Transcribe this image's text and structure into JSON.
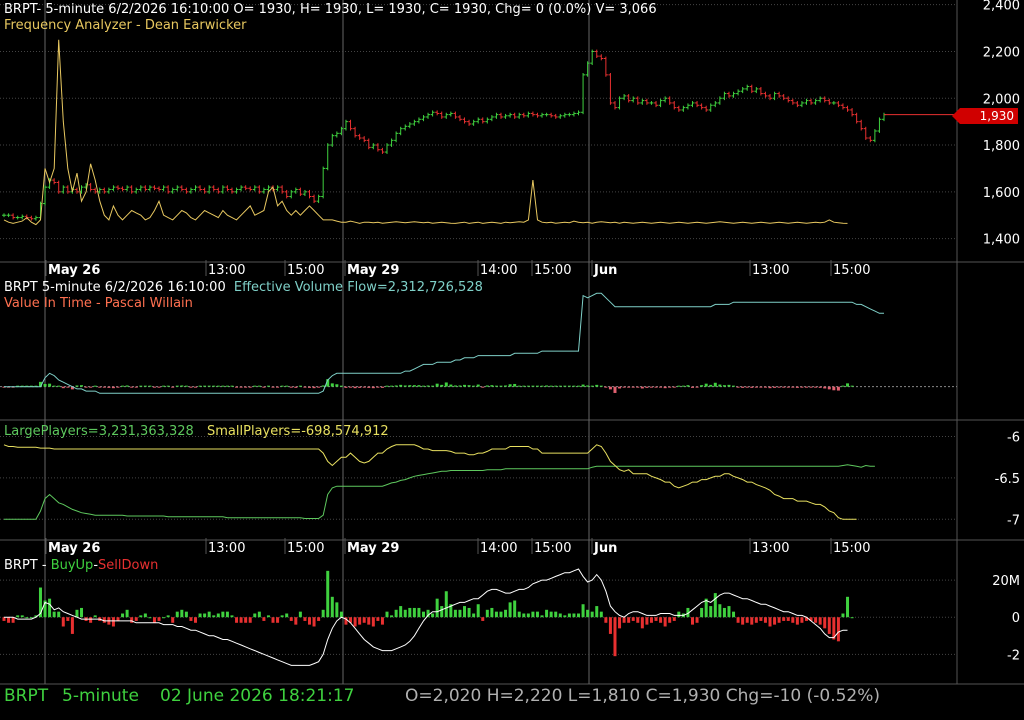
{
  "panel1": {
    "header": "BRPT- 5-minute 6/2/2026 16:10:00 O= 1930, H= 1930, L= 1930, C= 1930, Chg= 0 (0.0%) V= 3,066",
    "subtitle": "Frequency Analyzer - Dean Earwicker"
  },
  "panel2": {
    "header_prefix": "BRPT 5-minute  6/2/2026 16:10:00",
    "header_series": "Effective Volume Flow=2,312,726,528",
    "subtitle": "Value In Time - Pascal Willain"
  },
  "panel3": {
    "large_label": "LargePlayers=3,231,363,328",
    "small_label": "SmallPlayers=-698,574,912"
  },
  "panel4": {
    "prefix": "BRPT - ",
    "buy": "BuyUp",
    "dash": "-",
    "sell": "SellDown"
  },
  "price_tag": "1,930",
  "footer": {
    "symbol": "BRPT",
    "interval": "5-minute",
    "datetime": "02 June 2026 18:21:17",
    "ohlc": "O=2,020  H=2,220  L=1,810  C=1,930  Chg=-10 (-0.52%)"
  },
  "colors": {
    "up": "#3fd13f",
    "down": "#e83030",
    "freq": "#e8c860",
    "evf": "#7fd0c8",
    "large": "#5ec85e",
    "small": "#e8e060",
    "line4": "#ffffff",
    "axis_text": "#ffffff",
    "grid": "#444444"
  },
  "chart_data": {
    "type": "line",
    "date_labels": [
      "May 26",
      "13:00",
      "15:00",
      "May 29",
      "14:00",
      "15:00",
      "Jun",
      "13:00",
      "15:00"
    ],
    "price_axis": {
      "ylim": [
        1300,
        2420
      ],
      "ticks": [
        "1,400",
        "1,600",
        "1,800",
        "2,000",
        "2,200",
        "2,400"
      ]
    },
    "players_axis": {
      "ylim": [
        -7.25,
        -5.8
      ],
      "ticks": [
        "-6",
        "-6.5",
        "-7"
      ]
    },
    "buysell_axis": {
      "ylim": [
        -3.6,
        3.3
      ],
      "ticks": [
        "20M",
        "0",
        "-2"
      ]
    },
    "price_close": [
      1500,
      1500,
      1490,
      1490,
      1495,
      1490,
      1485,
      1490,
      1550,
      1620,
      1650,
      1640,
      1600,
      1620,
      1600,
      1610,
      1600,
      1620,
      1630,
      1610,
      1600,
      1610,
      1600,
      1610,
      1620,
      1615,
      1610,
      1620,
      1600,
      1610,
      1620,
      1610,
      1620,
      1615,
      1610,
      1620,
      1600,
      1610,
      1620,
      1610,
      1600,
      1610,
      1620,
      1610,
      1600,
      1620,
      1610,
      1600,
      1620,
      1610,
      1600,
      1610,
      1620,
      1615,
      1610,
      1620,
      1600,
      1610,
      1620,
      1610,
      1620,
      1600,
      1580,
      1600,
      1610,
      1590,
      1600,
      1580,
      1560,
      1580,
      1700,
      1800,
      1840,
      1850,
      1870,
      1900,
      1870,
      1840,
      1830,
      1820,
      1790,
      1800,
      1780,
      1770,
      1800,
      1820,
      1850,
      1870,
      1880,
      1890,
      1900,
      1910,
      1920,
      1930,
      1940,
      1935,
      1920,
      1930,
      1935,
      1920,
      1910,
      1900,
      1890,
      1900,
      1910,
      1900,
      1910,
      1920,
      1930,
      1920,
      1925,
      1930,
      1920,
      1930,
      1925,
      1935,
      1930,
      1925,
      1930,
      1930,
      1925,
      1920,
      1925,
      1930,
      1930,
      1935,
      1940,
      2100,
      2150,
      2200,
      2180,
      2170,
      2100,
      1980,
      1960,
      2000,
      2010,
      1990,
      2000,
      1980,
      1990,
      1980,
      1980,
      1970,
      1990,
      2000,
      1980,
      1960,
      1950,
      1960,
      1970,
      1980,
      1970,
      1960,
      1950,
      1970,
      1980,
      2000,
      2020,
      2010,
      2020,
      2030,
      2040,
      2050,
      2030,
      2040,
      2020,
      2010,
      2000,
      2020,
      2010,
      2000,
      1990,
      1980,
      1970,
      1980,
      1990,
      1980,
      1990,
      2000,
      1990,
      1980,
      1980,
      1970,
      1960,
      1950,
      1930,
      1900,
      1870,
      1830,
      1820,
      1860,
      1910,
      1930
    ],
    "frequency_analyzer": [
      1480,
      1470,
      1465,
      1470,
      1475,
      1490,
      1470,
      1460,
      1480,
      1700,
      1640,
      1700,
      2250,
      1900,
      1700,
      1600,
      1680,
      1560,
      1600,
      1720,
      1650,
      1560,
      1500,
      1480,
      1540,
      1500,
      1480,
      1500,
      1520,
      1510,
      1500,
      1480,
      1490,
      1520,
      1560,
      1500,
      1490,
      1480,
      1500,
      1520,
      1510,
      1490,
      1480,
      1500,
      1520,
      1510,
      1500,
      1490,
      1520,
      1500,
      1490,
      1480,
      1500,
      1520,
      1540,
      1500,
      1510,
      1520,
      1600,
      1620,
      1540,
      1560,
      1520,
      1500,
      1520,
      1500,
      1520,
      1540,
      1520,
      1500,
      1480,
      1480,
      1480,
      1475,
      1470,
      1470,
      1475,
      1470,
      1465,
      1470,
      1470,
      1468,
      1470,
      1466,
      1468,
      1470,
      1472,
      1470,
      1468,
      1470,
      1472,
      1470,
      1468,
      1470,
      1466,
      1468,
      1470,
      1468,
      1466,
      1465,
      1468,
      1470,
      1465,
      1468,
      1470,
      1465,
      1468,
      1470,
      1468,
      1465,
      1470,
      1468,
      1470,
      1472,
      1470,
      1480,
      1650,
      1480,
      1470,
      1468,
      1470,
      1466,
      1468,
      1470,
      1468,
      1475,
      1470,
      1468,
      1470,
      1466,
      1470,
      1472,
      1470,
      1468,
      1470,
      1466,
      1470,
      1468,
      1466,
      1468,
      1470,
      1468,
      1466,
      1468,
      1470,
      1468,
      1466,
      1468,
      1470,
      1468,
      1466,
      1468,
      1470,
      1468,
      1466,
      1468,
      1470,
      1472,
      1470,
      1468,
      1466,
      1468,
      1470,
      1468,
      1466,
      1468,
      1470,
      1468,
      1466,
      1468,
      1470,
      1468,
      1466,
      1468,
      1470,
      1468,
      1466,
      1468,
      1470,
      1468,
      1470,
      1480,
      1470,
      1468,
      1466,
      1465
    ],
    "effective_volume_flow": [
      0.0,
      0.0,
      0.0,
      0.0,
      0.0,
      0.0,
      0.0,
      0.0,
      0.0,
      0.4,
      0.6,
      0.5,
      0.3,
      0.2,
      0.1,
      0.0,
      -0.1,
      -0.1,
      -0.2,
      -0.2,
      -0.2,
      -0.3,
      -0.3,
      -0.3,
      -0.3,
      -0.3,
      -0.3,
      -0.3,
      -0.3,
      -0.3,
      -0.3,
      -0.3,
      -0.3,
      -0.3,
      -0.3,
      -0.3,
      -0.3,
      -0.3,
      -0.3,
      -0.3,
      -0.3,
      -0.3,
      -0.3,
      -0.3,
      -0.3,
      -0.3,
      -0.3,
      -0.3,
      -0.3,
      -0.3,
      -0.3,
      -0.3,
      -0.3,
      -0.3,
      -0.3,
      -0.3,
      -0.3,
      -0.3,
      -0.3,
      -0.3,
      -0.3,
      -0.3,
      -0.3,
      -0.3,
      -0.3,
      -0.3,
      -0.3,
      -0.3,
      -0.3,
      -0.3,
      -0.2,
      0.3,
      0.5,
      0.6,
      0.6,
      0.6,
      0.6,
      0.6,
      0.6,
      0.6,
      0.6,
      0.6,
      0.6,
      0.6,
      0.6,
      0.6,
      0.6,
      0.6,
      0.7,
      0.7,
      0.8,
      0.9,
      1.0,
      1.0,
      1.0,
      1.1,
      1.1,
      1.1,
      1.1,
      1.2,
      1.2,
      1.3,
      1.3,
      1.3,
      1.4,
      1.4,
      1.4,
      1.4,
      1.4,
      1.4,
      1.4,
      1.4,
      1.5,
      1.5,
      1.5,
      1.5,
      1.5,
      1.5,
      1.6,
      1.6,
      1.6,
      1.6,
      1.6,
      1.6,
      1.6,
      1.6,
      1.6,
      4.1,
      4.0,
      4.1,
      4.2,
      4.2,
      4.0,
      3.8,
      3.6,
      3.6,
      3.6,
      3.6,
      3.6,
      3.6,
      3.6,
      3.6,
      3.6,
      3.6,
      3.6,
      3.6,
      3.6,
      3.6,
      3.6,
      3.6,
      3.6,
      3.6,
      3.6,
      3.6,
      3.6,
      3.6,
      3.7,
      3.7,
      3.7,
      3.7,
      3.8,
      3.8,
      3.8,
      3.8,
      3.8,
      3.8,
      3.8,
      3.8,
      3.8,
      3.8,
      3.8,
      3.8,
      3.8,
      3.8,
      3.8,
      3.8,
      3.8,
      3.8,
      3.8,
      3.8,
      3.8,
      3.8,
      3.8,
      3.8,
      3.8,
      3.8,
      3.8,
      3.7,
      3.7,
      3.6,
      3.5,
      3.4,
      3.3,
      3.3
    ],
    "large_players": [
      -7.0,
      -7.0,
      -7.0,
      -7.0,
      -7.0,
      -7.0,
      -7.0,
      -7.0,
      -6.9,
      -6.75,
      -6.7,
      -6.75,
      -6.8,
      -6.82,
      -6.85,
      -6.88,
      -6.9,
      -6.92,
      -6.93,
      -6.94,
      -6.95,
      -6.95,
      -6.95,
      -6.95,
      -6.95,
      -6.95,
      -6.95,
      -6.96,
      -6.96,
      -6.96,
      -6.96,
      -6.96,
      -6.96,
      -6.96,
      -6.96,
      -6.96,
      -6.97,
      -6.97,
      -6.97,
      -6.97,
      -6.97,
      -6.97,
      -6.97,
      -6.97,
      -6.97,
      -6.97,
      -6.97,
      -6.97,
      -6.97,
      -6.98,
      -6.98,
      -6.98,
      -6.98,
      -6.98,
      -6.98,
      -6.98,
      -6.98,
      -6.98,
      -6.98,
      -6.98,
      -6.98,
      -6.98,
      -6.98,
      -6.98,
      -6.98,
      -6.98,
      -6.99,
      -6.99,
      -6.99,
      -6.99,
      -6.95,
      -6.7,
      -6.62,
      -6.6,
      -6.6,
      -6.6,
      -6.6,
      -6.6,
      -6.6,
      -6.6,
      -6.6,
      -6.6,
      -6.6,
      -6.6,
      -6.58,
      -6.56,
      -6.55,
      -6.53,
      -6.52,
      -6.5,
      -6.48,
      -6.47,
      -6.46,
      -6.45,
      -6.44,
      -6.43,
      -6.42,
      -6.42,
      -6.41,
      -6.41,
      -6.41,
      -6.41,
      -6.41,
      -6.41,
      -6.41,
      -6.41,
      -6.4,
      -6.4,
      -6.4,
      -6.4,
      -6.39,
      -6.39,
      -6.39,
      -6.39,
      -6.39,
      -6.39,
      -6.39,
      -6.39,
      -6.39,
      -6.39,
      -6.39,
      -6.39,
      -6.39,
      -6.39,
      -6.39,
      -6.39,
      -6.39,
      -6.39,
      -6.39,
      -6.37,
      -6.36,
      -6.36,
      -6.36,
      -6.36,
      -6.36,
      -6.36,
      -6.36,
      -6.36,
      -6.36,
      -6.36,
      -6.36,
      -6.36,
      -6.36,
      -6.36,
      -6.36,
      -6.36,
      -6.36,
      -6.36,
      -6.36,
      -6.36,
      -6.36,
      -6.36,
      -6.36,
      -6.36,
      -6.36,
      -6.36,
      -6.36,
      -6.36,
      -6.36,
      -6.36,
      -6.36,
      -6.36,
      -6.36,
      -6.36,
      -6.36,
      -6.36,
      -6.36,
      -6.36,
      -6.36,
      -6.36,
      -6.36,
      -6.36,
      -6.36,
      -6.36,
      -6.36,
      -6.36,
      -6.36,
      -6.36,
      -6.36,
      -6.36,
      -6.36,
      -6.36,
      -6.36,
      -6.36,
      -6.35,
      -6.34,
      -6.35,
      -6.36,
      -6.37,
      -6.35,
      -6.36,
      -6.36
    ],
    "small_players": [
      -6.1,
      -6.12,
      -6.12,
      -6.13,
      -6.13,
      -6.13,
      -6.13,
      -6.13,
      -6.14,
      -6.14,
      -6.14,
      -6.15,
      -6.15,
      -6.15,
      -6.15,
      -6.15,
      -6.15,
      -6.15,
      -6.15,
      -6.15,
      -6.15,
      -6.15,
      -6.15,
      -6.15,
      -6.15,
      -6.15,
      -6.15,
      -6.15,
      -6.15,
      -6.15,
      -6.15,
      -6.15,
      -6.15,
      -6.15,
      -6.15,
      -6.15,
      -6.15,
      -6.15,
      -6.15,
      -6.15,
      -6.15,
      -6.15,
      -6.15,
      -6.15,
      -6.15,
      -6.15,
      -6.15,
      -6.15,
      -6.15,
      -6.15,
      -6.15,
      -6.15,
      -6.15,
      -6.15,
      -6.15,
      -6.15,
      -6.15,
      -6.15,
      -6.15,
      -6.15,
      -6.15,
      -6.15,
      -6.15,
      -6.15,
      -6.15,
      -6.15,
      -6.15,
      -6.15,
      -6.15,
      -6.15,
      -6.2,
      -6.3,
      -6.35,
      -6.3,
      -6.25,
      -6.25,
      -6.2,
      -6.25,
      -6.3,
      -6.32,
      -6.3,
      -6.25,
      -6.2,
      -6.2,
      -6.15,
      -6.12,
      -6.1,
      -6.1,
      -6.1,
      -6.1,
      -6.1,
      -6.12,
      -6.15,
      -6.15,
      -6.17,
      -6.17,
      -6.17,
      -6.17,
      -6.18,
      -6.2,
      -6.2,
      -6.2,
      -6.22,
      -6.22,
      -6.2,
      -6.2,
      -6.18,
      -6.15,
      -6.15,
      -6.15,
      -6.15,
      -6.12,
      -6.12,
      -6.12,
      -6.12,
      -6.12,
      -6.15,
      -6.15,
      -6.2,
      -6.2,
      -6.2,
      -6.2,
      -6.2,
      -6.2,
      -6.2,
      -6.2,
      -6.2,
      -6.2,
      -6.2,
      -6.15,
      -6.1,
      -6.12,
      -6.2,
      -6.3,
      -6.35,
      -6.4,
      -6.42,
      -6.4,
      -6.45,
      -6.45,
      -6.45,
      -6.45,
      -6.48,
      -6.5,
      -6.52,
      -6.55,
      -6.55,
      -6.6,
      -6.62,
      -6.6,
      -6.58,
      -6.55,
      -6.55,
      -6.52,
      -6.52,
      -6.5,
      -6.48,
      -6.48,
      -6.45,
      -6.45,
      -6.48,
      -6.5,
      -6.52,
      -6.55,
      -6.55,
      -6.58,
      -6.6,
      -6.62,
      -6.65,
      -6.7,
      -6.72,
      -6.75,
      -6.75,
      -6.75,
      -6.78,
      -6.78,
      -6.78,
      -6.8,
      -6.82,
      -6.82,
      -6.85,
      -6.9,
      -6.92,
      -6.98,
      -7.0,
      -7.0,
      -7.0,
      -7.0
    ],
    "buysell_line": [
      0.0,
      0.0,
      0.0,
      -0.1,
      -0.1,
      -0.1,
      -0.1,
      0.0,
      0.2,
      0.8,
      0.7,
      0.4,
      0.5,
      0.3,
      0.2,
      0.1,
      0.0,
      -0.1,
      -0.1,
      -0.1,
      -0.1,
      -0.1,
      -0.2,
      -0.2,
      -0.2,
      -0.2,
      -0.2,
      -0.2,
      -0.2,
      -0.3,
      -0.3,
      -0.3,
      -0.3,
      -0.3,
      -0.3,
      -0.4,
      -0.4,
      -0.4,
      -0.5,
      -0.5,
      -0.6,
      -0.7,
      -0.7,
      -0.8,
      -0.9,
      -1.0,
      -1.0,
      -1.1,
      -1.2,
      -1.2,
      -1.3,
      -1.4,
      -1.5,
      -1.6,
      -1.7,
      -1.8,
      -1.9,
      -2.0,
      -2.1,
      -2.2,
      -2.3,
      -2.4,
      -2.5,
      -2.6,
      -2.6,
      -2.6,
      -2.6,
      -2.6,
      -2.5,
      -2.4,
      -2.0,
      -1.2,
      -0.6,
      -0.2,
      0.0,
      -0.1,
      -0.3,
      -0.6,
      -0.9,
      -1.2,
      -1.4,
      -1.6,
      -1.7,
      -1.8,
      -1.8,
      -1.8,
      -1.7,
      -1.6,
      -1.5,
      -1.3,
      -1.0,
      -0.6,
      -0.2,
      0.1,
      0.3,
      0.3,
      0.4,
      0.5,
      0.6,
      0.7,
      0.8,
      0.8,
      0.9,
      1.0,
      1.0,
      1.2,
      1.4,
      1.5,
      1.5,
      1.4,
      1.3,
      1.3,
      1.4,
      1.5,
      1.5,
      1.6,
      1.8,
      1.9,
      2.0,
      2.0,
      2.1,
      2.2,
      2.3,
      2.4,
      2.4,
      2.5,
      2.6,
      2.2,
      1.9,
      2.0,
      2.3,
      2.0,
      1.4,
      0.6,
      0.3,
      0.1,
      0.0,
      0.2,
      0.3,
      0.3,
      0.2,
      0.1,
      0.1,
      0.1,
      0.2,
      0.2,
      0.2,
      0.1,
      0.1,
      0.1,
      0.2,
      0.4,
      0.6,
      0.8,
      0.9,
      0.8,
      1.0,
      1.2,
      1.3,
      1.3,
      1.2,
      1.1,
      1.0,
      1.0,
      0.9,
      0.8,
      0.7,
      0.7,
      0.6,
      0.5,
      0.4,
      0.3,
      0.3,
      0.2,
      0.1,
      0.1,
      0.0,
      -0.2,
      -0.4,
      -0.6,
      -0.9,
      -1.1,
      -1.1,
      -0.8,
      -0.7,
      -0.7
    ],
    "buysell_bars": [
      -0.2,
      -0.3,
      -0.3,
      0.1,
      0.1,
      0.0,
      0.0,
      0.1,
      1.6,
      0.9,
      1.0,
      0.3,
      0.3,
      -0.5,
      -0.2,
      -0.9,
      0.4,
      0.5,
      -0.2,
      -0.3,
      0.1,
      -0.2,
      -0.3,
      -0.4,
      -0.5,
      -0.2,
      0.2,
      0.4,
      -0.3,
      -0.2,
      0.1,
      0.2,
      0.0,
      -0.3,
      -0.2,
      0.0,
      0.1,
      -0.3,
      0.3,
      0.4,
      0.3,
      -0.2,
      -0.3,
      0.2,
      0.2,
      0.3,
      0.1,
      0.2,
      0.3,
      0.3,
      0.1,
      -0.3,
      -0.3,
      -0.3,
      -0.3,
      0.2,
      0.3,
      -0.2,
      0.1,
      -0.3,
      -0.3,
      0.1,
      0.2,
      -0.2,
      -0.4,
      0.3,
      -0.2,
      -0.4,
      -0.5,
      -0.2,
      0.4,
      2.5,
      1.1,
      0.8,
      0.3,
      -0.4,
      -0.3,
      -0.5,
      -0.4,
      -0.3,
      -0.4,
      -0.5,
      -0.2,
      -0.4,
      0.3,
      0.1,
      0.4,
      0.6,
      0.4,
      0.5,
      0.5,
      0.5,
      0.3,
      0.4,
      0.2,
      1.0,
      0.6,
      1.4,
      0.7,
      0.4,
      0.4,
      0.6,
      0.5,
      0.2,
      0.7,
      -0.2,
      0.4,
      0.5,
      0.3,
      0.3,
      0.4,
      0.8,
      0.9,
      0.3,
      0.2,
      0.2,
      0.3,
      0.3,
      0.1,
      0.4,
      0.3,
      0.3,
      0.2,
      0.1,
      0.2,
      0.2,
      0.2,
      0.7,
      0.4,
      0.3,
      0.6,
      0.3,
      -0.3,
      -0.9,
      -2.1,
      -0.6,
      -0.3,
      -0.3,
      -0.2,
      -0.3,
      -0.6,
      -0.4,
      -0.3,
      -0.2,
      -0.3,
      -0.5,
      -0.3,
      -0.2,
      0.3,
      0.2,
      0.5,
      -0.4,
      -0.3,
      0.5,
      1.0,
      0.6,
      1.3,
      0.7,
      0.5,
      0.6,
      0.3,
      -0.3,
      -0.4,
      -0.3,
      -0.4,
      -0.3,
      -0.2,
      -0.3,
      -0.5,
      -0.4,
      -0.3,
      -0.2,
      -0.2,
      -0.3,
      -0.4,
      -0.3,
      -0.2,
      -0.2,
      -0.3,
      -0.4,
      -0.6,
      -0.9,
      -1.2,
      -1.3,
      0.2,
      1.1,
      0.0
    ]
  }
}
